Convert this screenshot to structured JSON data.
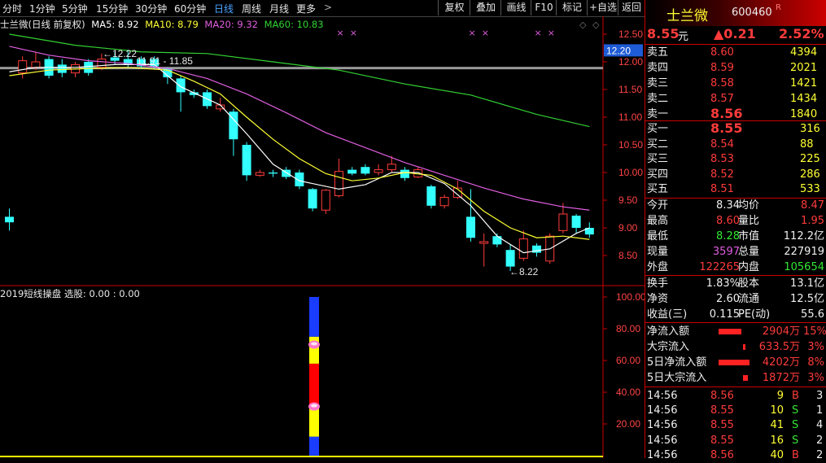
{
  "tabs": [
    "分时",
    "1分钟",
    "5分钟",
    "15分钟",
    "30分钟",
    "60分钟",
    "日线",
    "周线",
    "月线",
    "更多"
  ],
  "active_tab": "日线",
  "more_arrow": ">",
  "toolbar": [
    "复权",
    "叠加",
    "画线",
    "F10",
    "标记",
    "+自选",
    "返回"
  ],
  "legend": {
    "name": "士兰微(日线 前复权)",
    "ma5": "MA5: 8.92",
    "ma10": "MA10: 8.79",
    "ma20": "MA20: 9.32",
    "ma60": "MA60: 10.83"
  },
  "colors": {
    "ma5": "#ffffff",
    "ma10": "#ffff33",
    "ma20": "#e05ee0",
    "ma60": "#33d133",
    "up": "#ff3b3b",
    "down": "#33ffff",
    "hline": "#9a9a9a"
  },
  "main_axis": {
    "ticks": [
      "12.50",
      "12.00",
      "11.50",
      "11.00",
      "10.50",
      "10.00",
      "9.50",
      "9.00",
      "8.50"
    ],
    "highlight": "12.20"
  },
  "annotations": {
    "high": "12.22",
    "range": "11.91 - 11.85",
    "low": "8.22"
  },
  "candles": [
    {
      "o": 9.2,
      "c": 9.1,
      "h": 9.35,
      "l": 8.95
    },
    {
      "o": 11.8,
      "c": 12.02,
      "h": 12.1,
      "l": 11.7
    },
    {
      "o": 11.9,
      "c": 12.0,
      "h": 12.18,
      "l": 11.85
    },
    {
      "o": 12.05,
      "c": 11.75,
      "h": 12.1,
      "l": 11.7
    },
    {
      "o": 11.95,
      "c": 11.8,
      "h": 12.05,
      "l": 11.72
    },
    {
      "o": 11.8,
      "c": 11.95,
      "h": 12.0,
      "l": 11.72
    },
    {
      "o": 12.0,
      "c": 11.8,
      "h": 12.05,
      "l": 11.75
    },
    {
      "o": 11.9,
      "c": 12.05,
      "h": 12.15,
      "l": 11.85
    },
    {
      "o": 12.08,
      "c": 12.02,
      "h": 12.18,
      "l": 11.95
    },
    {
      "o": 12.05,
      "c": 11.95,
      "h": 12.22,
      "l": 11.9
    },
    {
      "o": 12.05,
      "c": 11.92,
      "h": 12.1,
      "l": 11.88
    },
    {
      "o": 12.05,
      "c": 11.92,
      "h": 12.1,
      "l": 11.86
    },
    {
      "o": 11.88,
      "c": 11.72,
      "h": 11.9,
      "l": 11.6
    },
    {
      "o": 11.7,
      "c": 11.45,
      "h": 11.75,
      "l": 11.1
    },
    {
      "o": 11.45,
      "c": 11.4,
      "h": 11.5,
      "l": 11.35
    },
    {
      "o": 11.45,
      "c": 11.2,
      "h": 11.5,
      "l": 11.15
    },
    {
      "o": 11.15,
      "c": 11.22,
      "h": 11.35,
      "l": 11.1
    },
    {
      "o": 11.1,
      "c": 10.6,
      "h": 11.15,
      "l": 10.3
    },
    {
      "o": 10.5,
      "c": 9.95,
      "h": 10.55,
      "l": 9.85
    },
    {
      "o": 9.95,
      "c": 10.0,
      "h": 10.05,
      "l": 9.92
    },
    {
      "o": 10.0,
      "c": 9.98,
      "h": 10.05,
      "l": 9.92
    },
    {
      "o": 10.05,
      "c": 9.92,
      "h": 10.1,
      "l": 9.88
    },
    {
      "o": 10.0,
      "c": 9.75,
      "h": 10.05,
      "l": 9.7
    },
    {
      "o": 9.7,
      "c": 9.35,
      "h": 9.72,
      "l": 9.3
    },
    {
      "o": 9.32,
      "c": 9.68,
      "h": 9.7,
      "l": 9.25
    },
    {
      "o": 9.58,
      "c": 10.02,
      "h": 10.25,
      "l": 9.55
    },
    {
      "o": 10.05,
      "c": 9.98,
      "h": 10.1,
      "l": 9.95
    },
    {
      "o": 10.1,
      "c": 9.98,
      "h": 10.15,
      "l": 9.95
    },
    {
      "o": 10.0,
      "c": 10.05,
      "h": 10.15,
      "l": 9.95
    },
    {
      "o": 10.05,
      "c": 10.15,
      "h": 10.3,
      "l": 10.0
    },
    {
      "o": 10.05,
      "c": 9.9,
      "h": 10.1,
      "l": 9.85
    },
    {
      "o": 9.92,
      "c": 10.05,
      "h": 10.1,
      "l": 9.9
    },
    {
      "o": 9.75,
      "c": 9.4,
      "h": 9.78,
      "l": 9.35
    },
    {
      "o": 9.4,
      "c": 9.55,
      "h": 9.6,
      "l": 9.35
    },
    {
      "o": 9.55,
      "c": 9.72,
      "h": 9.85,
      "l": 9.52
    },
    {
      "o": 9.2,
      "c": 8.82,
      "h": 9.7,
      "l": 8.75
    },
    {
      "o": 8.72,
      "c": 8.75,
      "h": 8.9,
      "l": 8.3
    },
    {
      "o": 8.85,
      "c": 8.7,
      "h": 8.9,
      "l": 8.65
    },
    {
      "o": 8.6,
      "c": 8.3,
      "h": 8.7,
      "l": 8.22
    },
    {
      "o": 8.45,
      "c": 8.8,
      "h": 8.95,
      "l": 8.4
    },
    {
      "o": 8.68,
      "c": 8.55,
      "h": 8.72,
      "l": 8.48
    },
    {
      "o": 8.4,
      "c": 8.85,
      "h": 8.9,
      "l": 8.35
    },
    {
      "o": 8.95,
      "c": 9.25,
      "h": 9.45,
      "l": 8.9
    },
    {
      "o": 9.22,
      "c": 9.0,
      "h": 9.25,
      "l": 8.9
    },
    {
      "o": 9.0,
      "c": 8.88,
      "h": 9.1,
      "l": 8.82
    }
  ],
  "ma5_line": [
    [
      0,
      11.82
    ],
    [
      2,
      11.9
    ],
    [
      5,
      11.9
    ],
    [
      8,
      11.95
    ],
    [
      11,
      11.95
    ],
    [
      13,
      11.55
    ],
    [
      16,
      11.22
    ],
    [
      18,
      10.7
    ],
    [
      20,
      10.15
    ],
    [
      22,
      9.85
    ],
    [
      25,
      9.7
    ],
    [
      27,
      9.78
    ],
    [
      29,
      10.0
    ],
    [
      31,
      10.0
    ],
    [
      33,
      9.8
    ],
    [
      35,
      9.4
    ],
    [
      37,
      8.85
    ],
    [
      39,
      8.55
    ],
    [
      41,
      8.62
    ],
    [
      43,
      8.9
    ],
    [
      44,
      9.0
    ]
  ],
  "ma10_line": [
    [
      0,
      11.75
    ],
    [
      3,
      11.85
    ],
    [
      6,
      11.88
    ],
    [
      9,
      11.9
    ],
    [
      12,
      11.85
    ],
    [
      14,
      11.65
    ],
    [
      16,
      11.42
    ],
    [
      18,
      11.0
    ],
    [
      20,
      10.6
    ],
    [
      22,
      10.25
    ],
    [
      24,
      9.98
    ],
    [
      26,
      9.85
    ],
    [
      28,
      9.9
    ],
    [
      30,
      10.0
    ],
    [
      32,
      9.95
    ],
    [
      34,
      9.7
    ],
    [
      36,
      9.3
    ],
    [
      38,
      9.0
    ],
    [
      40,
      8.82
    ],
    [
      42,
      8.85
    ],
    [
      44,
      8.79
    ]
  ],
  "ma20_line": [
    [
      0,
      12.28
    ],
    [
      3,
      12.12
    ],
    [
      6,
      12.02
    ],
    [
      9,
      11.97
    ],
    [
      12,
      11.88
    ],
    [
      15,
      11.7
    ],
    [
      18,
      11.42
    ],
    [
      21,
      11.08
    ],
    [
      24,
      10.72
    ],
    [
      27,
      10.45
    ],
    [
      30,
      10.18
    ],
    [
      33,
      9.95
    ],
    [
      36,
      9.72
    ],
    [
      39,
      9.52
    ],
    [
      42,
      9.38
    ],
    [
      44,
      9.32
    ]
  ],
  "ma60_line": [
    [
      0,
      12.5
    ],
    [
      5,
      12.3
    ],
    [
      10,
      12.18
    ],
    [
      15,
      12.15
    ],
    [
      20,
      12.0
    ],
    [
      25,
      11.85
    ],
    [
      30,
      11.6
    ],
    [
      35,
      11.4
    ],
    [
      40,
      11.05
    ],
    [
      44,
      10.83
    ]
  ],
  "hline_value": 11.88,
  "markers": [
    25,
    26,
    35,
    36,
    40,
    41
  ],
  "indicator": {
    "title": "2019短线操盘 选股: 0.00 : 0.00",
    "ticks": [
      "100.00",
      "80.00",
      "60.00",
      "40.00",
      "20.00"
    ]
  },
  "indicator_bar": {
    "index": 23,
    "segments": [
      {
        "from": 0,
        "to": 12,
        "color": "#1a3cff"
      },
      {
        "from": 12,
        "to": 30,
        "color": "#ffff00"
      },
      {
        "from": 30,
        "to": 58,
        "color": "#ff0000"
      },
      {
        "from": 58,
        "to": 75,
        "color": "#ffff00"
      },
      {
        "from": 75,
        "to": 100,
        "color": "#1a3cff"
      }
    ],
    "dots": [
      70,
      31
    ]
  },
  "stock": {
    "name": "士兰微",
    "code": "600460",
    "r": "R",
    "price": "8.55",
    "price_unit": "元",
    "change": "▲0.21",
    "pct": "2.52%"
  },
  "asks": [
    {
      "label": "卖五",
      "p": "8.60",
      "v": "4394"
    },
    {
      "label": "卖四",
      "p": "8.59",
      "v": "2021"
    },
    {
      "label": "卖三",
      "p": "8.58",
      "v": "1421"
    },
    {
      "label": "卖二",
      "p": "8.57",
      "v": "1434"
    },
    {
      "label": "卖一",
      "p": "8.56",
      "v": "1840"
    }
  ],
  "bids": [
    {
      "label": "买一",
      "p": "8.55",
      "v": "316"
    },
    {
      "label": "买二",
      "p": "8.54",
      "v": "88"
    },
    {
      "label": "买三",
      "p": "8.53",
      "v": "225"
    },
    {
      "label": "买四",
      "p": "8.52",
      "v": "286"
    },
    {
      "label": "买五",
      "p": "8.51",
      "v": "533"
    }
  ],
  "quote": [
    {
      "l1": "今开",
      "v1": "8.34",
      "c1": "white",
      "l2": "均价",
      "v2": "8.47",
      "c2": "red"
    },
    {
      "l1": "最高",
      "v1": "8.60",
      "c1": "red",
      "l2": "量比",
      "v2": "1.95",
      "c2": "red"
    },
    {
      "l1": "最低",
      "v1": "8.28",
      "c1": "green",
      "l2": "市值",
      "v2": "112.2亿",
      "c2": "white"
    },
    {
      "l1": "现量",
      "v1": "3597",
      "c1": "purple",
      "l2": "总量",
      "v2": "227919",
      "c2": "white"
    },
    {
      "l1": "外盘",
      "v1": "122265",
      "c1": "red",
      "l2": "内盘",
      "v2": "105654",
      "c2": "green"
    }
  ],
  "fund": [
    {
      "l1": "换手",
      "v1": "1.83%",
      "l2": "股本",
      "v2": "13.1亿"
    },
    {
      "l1": "净资",
      "v1": "2.60",
      "l2": "流通",
      "v2": "12.5亿"
    },
    {
      "l1": "收益(三)",
      "v1": "0.115",
      "l2": "PE(动)",
      "v2": "55.6"
    }
  ],
  "flows": [
    {
      "label": "净流入额",
      "bar": 28,
      "v": "2904万",
      "pct": "15%"
    },
    {
      "label": "大宗流入",
      "bar": 3,
      "v": "633.5万",
      "pct": "3%"
    },
    {
      "label": "5日净流入额",
      "bar": 38,
      "v": "4202万",
      "pct": "8%"
    },
    {
      "label": "5日大宗流入",
      "bar": 6,
      "v": "1872万",
      "pct": "3%"
    }
  ],
  "ticks_tbl": [
    {
      "t": "14:56",
      "p": "8.56",
      "v": "9",
      "s": "B",
      "n": "3"
    },
    {
      "t": "14:56",
      "p": "8.55",
      "v": "10",
      "s": "S",
      "n": "1"
    },
    {
      "t": "14:56",
      "p": "8.55",
      "v": "41",
      "s": "S",
      "n": "4"
    },
    {
      "t": "14:56",
      "p": "8.55",
      "v": "16",
      "s": "S",
      "n": "2"
    },
    {
      "t": "14:56",
      "p": "8.56",
      "v": "40",
      "s": "B",
      "n": "2"
    }
  ]
}
